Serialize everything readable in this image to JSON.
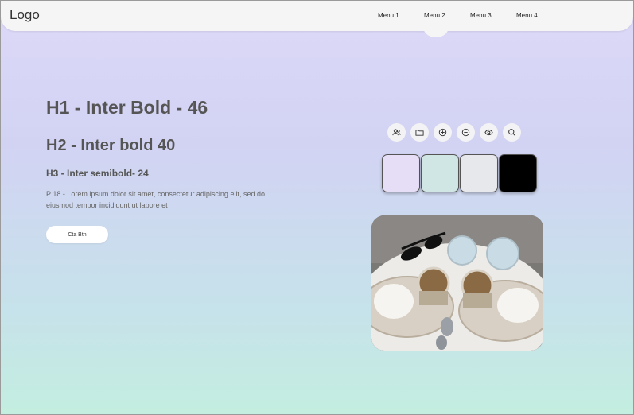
{
  "navbar": {
    "logo": "Logo",
    "menu": [
      "Menu 1",
      "Menu 2",
      "Menu 3",
      "Menu 4"
    ]
  },
  "hero": {
    "h1": "H1 - Inter Bold - 46",
    "h2": "H2 - Inter bold 40",
    "h3": "H3 - Inter semibold- 24",
    "paragraph": "P 18 - Lorem ipsum dolor sit amet, consectetur adipiscing elit, sed do eiusmod tempor incididunt ut labore et",
    "cta_label": "Cta Btn"
  },
  "icons": [
    "users-icon",
    "folder-icon",
    "plus-circle-icon",
    "minus-circle-icon",
    "eye-icon",
    "search-icon"
  ],
  "swatches": [
    "#e6ddf7",
    "#cfe6e5",
    "#e6e8ec",
    "#000000"
  ],
  "colors": {
    "gradient_top": "#ddd8f8",
    "gradient_bottom": "#c4eee0",
    "navbar_bg": "#f5f5f6",
    "heading": "#555555"
  }
}
